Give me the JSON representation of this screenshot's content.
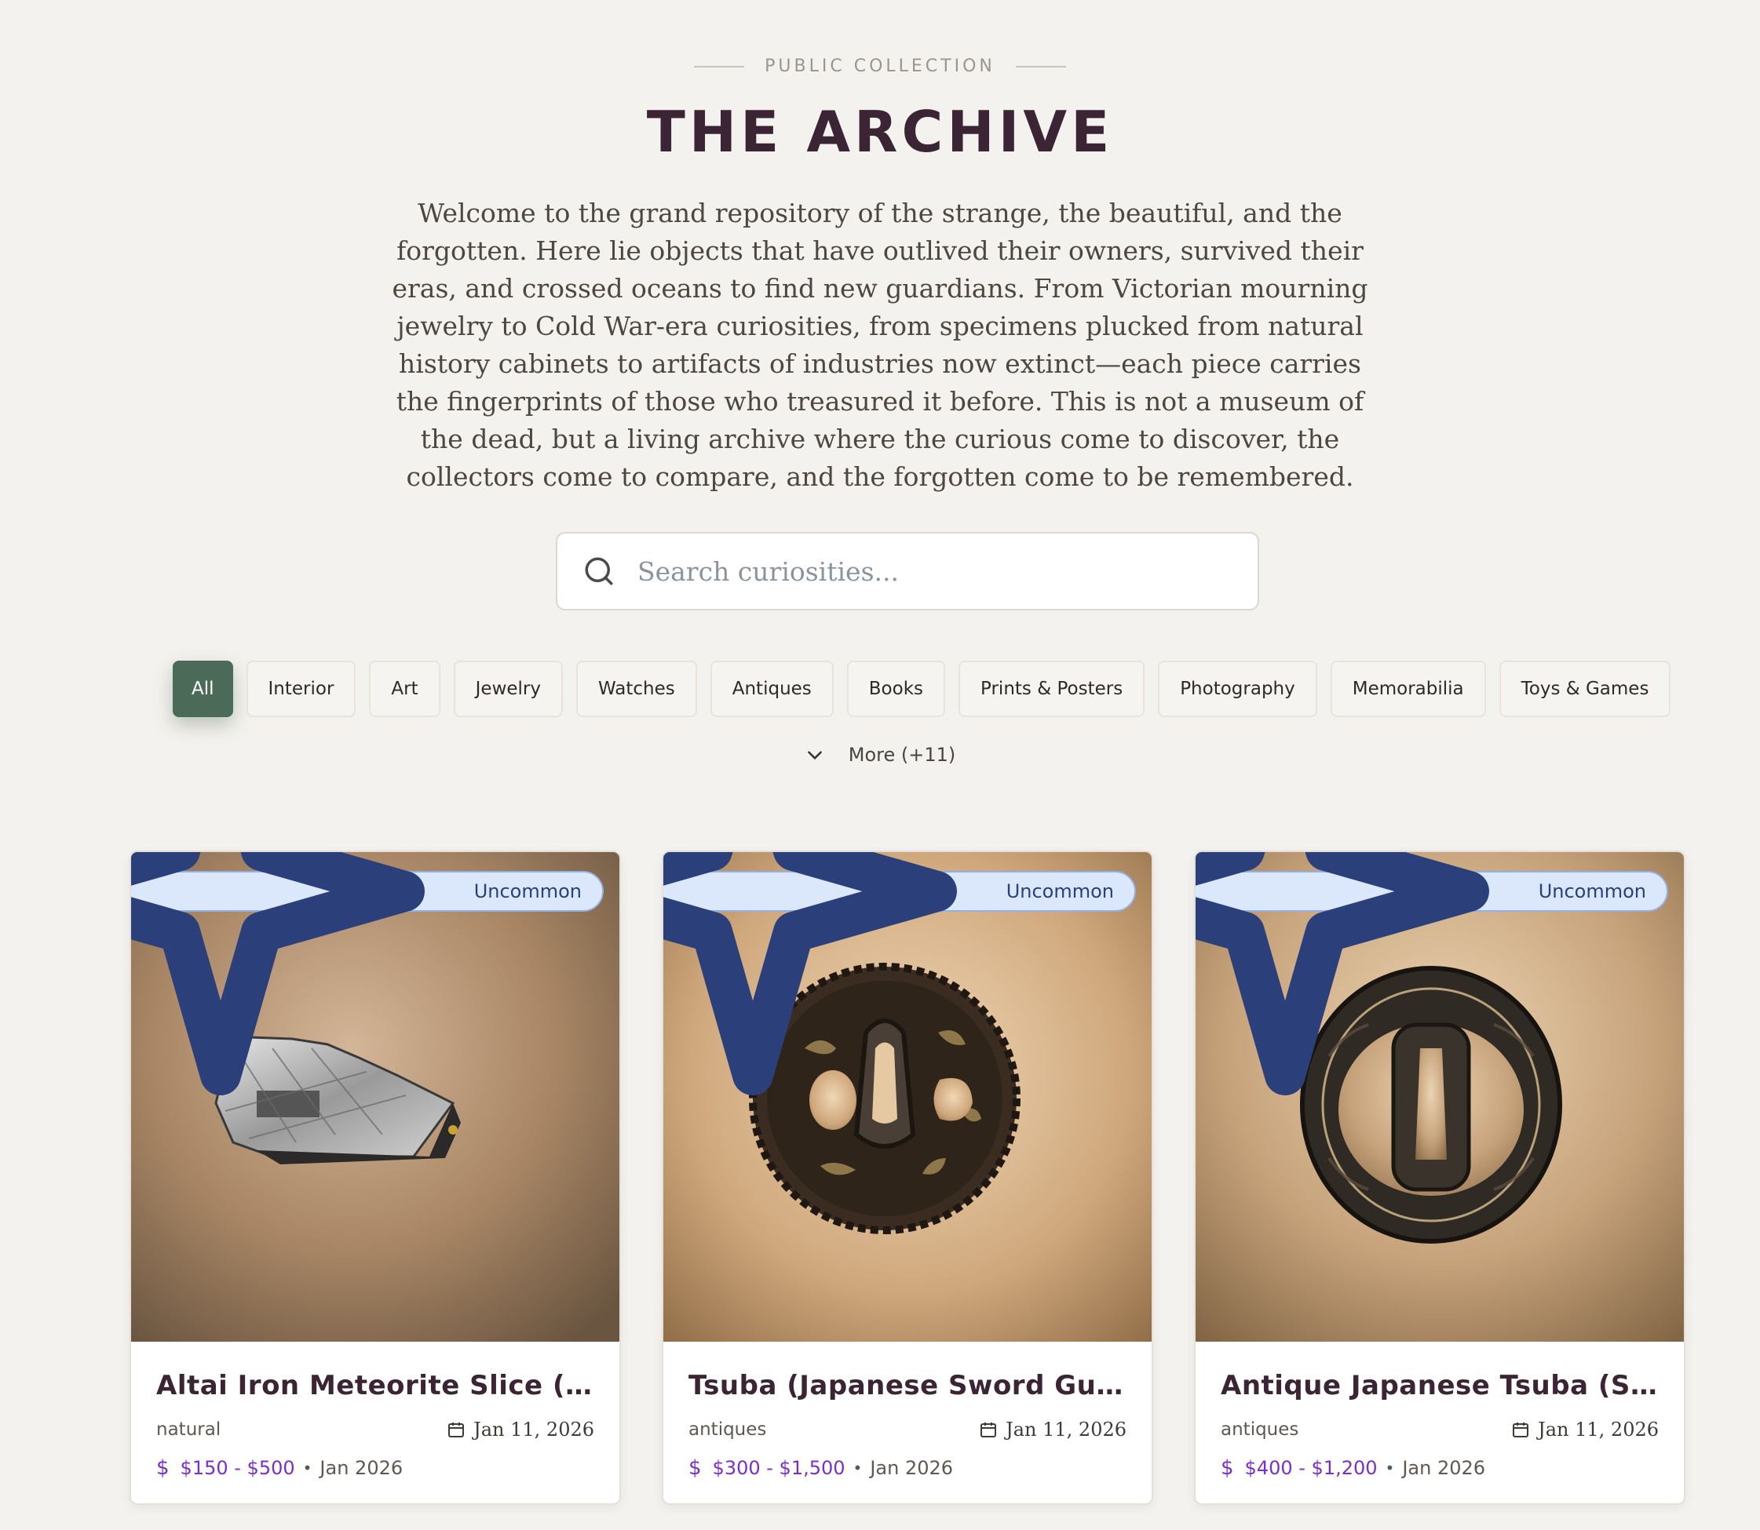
{
  "header": {
    "eyebrow": "PUBLIC COLLECTION",
    "title": "THE ARCHIVE",
    "intro": "Welcome to the grand repository of the strange, the beautiful, and the forgotten. Here lie objects that have outlived their owners, survived their eras, and crossed oceans to find new guardians. From Victorian mourning jewelry to Cold War-era curiosities, from specimens plucked from natural history cabinets to artifacts of industries now extinct—each piece carries the fingerprints of those who treasured it before. This is not a museum of the dead, but a living archive where the curious come to discover, the collectors come to compare, and the forgotten come to be remembered."
  },
  "search": {
    "placeholder": "Search curiosities...",
    "value": "",
    "icon": "search-icon"
  },
  "filters": {
    "active": "All",
    "chips": [
      "All",
      "Interior",
      "Art",
      "Jewelry",
      "Watches",
      "Antiques",
      "Books",
      "Prints & Posters",
      "Photography",
      "Memorabilia",
      "Toys & Games"
    ],
    "more_label": "More (+11)"
  },
  "items": [
    {
      "rarity": "Uncommon",
      "name": "Altai Iron Meteorite Slice (Wi...",
      "category": "natural",
      "date": "Jan 11, 2026",
      "price": "$150 - $500",
      "period": "Jan 2026"
    },
    {
      "rarity": "Uncommon",
      "name": "Tsuba (Japanese Sword Guar...",
      "category": "antiques",
      "date": "Jan 11, 2026",
      "price": "$300 - $1,500",
      "period": "Jan 2026"
    },
    {
      "rarity": "Uncommon",
      "name": "Antique Japanese Tsuba (Sw...",
      "category": "antiques",
      "date": "Jan 11, 2026",
      "price": "$400 - $1,200",
      "period": "Jan 2026"
    }
  ],
  "colors": {
    "background": "#f4f2ee",
    "title": "#3b2535",
    "active_chip": "#4c6a58",
    "price": "#7a2fc9",
    "badge_bg": "#dbe8fb",
    "badge_border": "#93b0e3"
  }
}
